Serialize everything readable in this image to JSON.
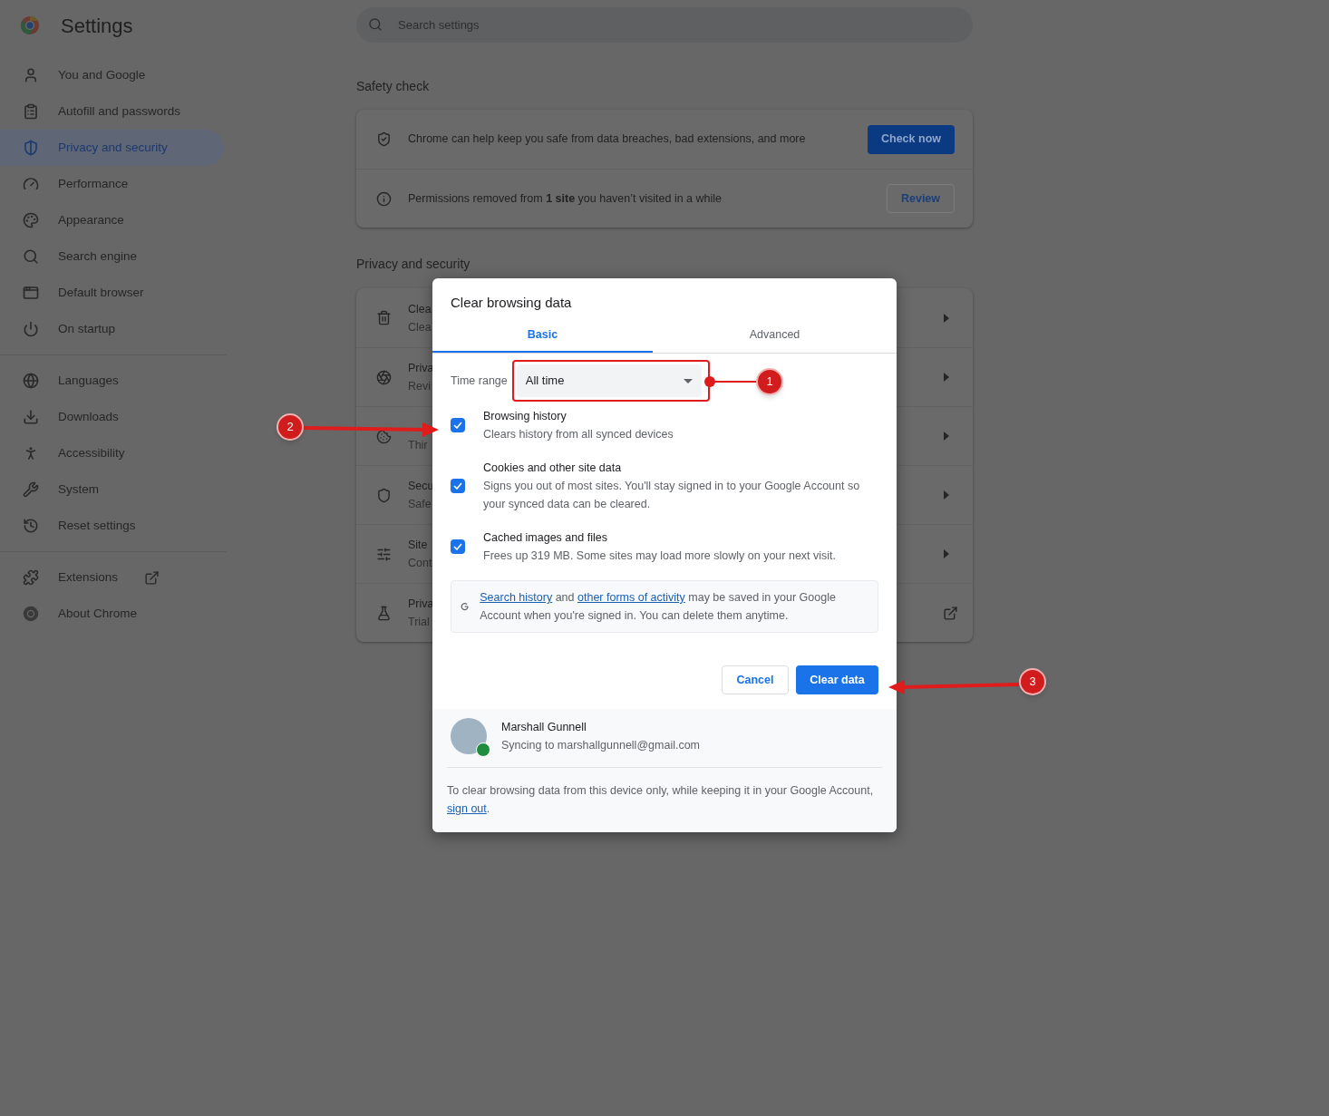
{
  "window": {
    "title": "Settings"
  },
  "search": {
    "placeholder": "Search settings"
  },
  "sidebar": {
    "groups": [
      [
        {
          "label": "You and Google",
          "selected": false,
          "external": false
        },
        {
          "label": "Autofill and passwords",
          "selected": false,
          "external": false
        },
        {
          "label": "Privacy and security",
          "selected": true,
          "external": false
        },
        {
          "label": "Performance",
          "selected": false,
          "external": false
        },
        {
          "label": "Appearance",
          "selected": false,
          "external": false
        },
        {
          "label": "Search engine",
          "selected": false,
          "external": false
        },
        {
          "label": "Default browser",
          "selected": false,
          "external": false
        },
        {
          "label": "On startup",
          "selected": false,
          "external": false
        }
      ],
      [
        {
          "label": "Languages",
          "selected": false,
          "external": false
        },
        {
          "label": "Downloads",
          "selected": false,
          "external": false
        },
        {
          "label": "Accessibility",
          "selected": false,
          "external": false
        },
        {
          "label": "System",
          "selected": false,
          "external": false
        },
        {
          "label": "Reset settings",
          "selected": false,
          "external": false
        }
      ],
      [
        {
          "label": "Extensions",
          "selected": false,
          "external": true
        },
        {
          "label": "About Chrome",
          "selected": false,
          "external": false
        }
      ]
    ]
  },
  "safety_check": {
    "heading": "Safety check",
    "rows": [
      {
        "text": "Chrome can help keep you safe from data breaches, bad extensions, and more",
        "button": "Check now",
        "kind": "primary"
      },
      {
        "text": "Permissions removed from **1 site** you haven’t visited in a while",
        "button": "Review",
        "kind": "secondary"
      }
    ]
  },
  "privacy": {
    "heading": "Privacy and security",
    "rows": [
      {
        "title": "Clea",
        "subtitle": "Clea",
        "kind": "arrow"
      },
      {
        "title": "Priva",
        "subtitle": "Revi",
        "kind": "arrow"
      },
      {
        "subtitle": "Thir",
        "kind": "arrow"
      },
      {
        "title": "Secu",
        "subtitle": "Safe",
        "kind": "arrow"
      },
      {
        "title": "Site",
        "subtitle": "Cont",
        "kind": "arrow"
      },
      {
        "title": "Priva",
        "subtitle": "Trial",
        "kind": "external"
      }
    ]
  },
  "dialog": {
    "title": "Clear browsing data",
    "tabs": [
      {
        "label": "Basic",
        "selected": true
      },
      {
        "label": "Advanced",
        "selected": false
      }
    ],
    "time_range": {
      "label": "Time range",
      "value": "All time"
    },
    "options": [
      {
        "title": "Browsing history",
        "description": "Clears history from all synced devices",
        "checked": true
      },
      {
        "title": "Cookies and other site data",
        "description": "Signs you out of most sites. You'll stay signed in to your Google Account so your synced data can be cleared.",
        "checked": true
      },
      {
        "title": "Cached images and files",
        "description": "Frees up 319 MB. Some sites may load more slowly on your next visit.",
        "checked": true
      }
    ],
    "notice": [
      {
        "text": "Search history",
        "link": true
      },
      {
        "text": " and ",
        "link": false
      },
      {
        "text": "other forms of activity",
        "link": true
      },
      {
        "text": " may be saved in your Google Account when you're signed in. You can delete them anytime.",
        "link": false
      }
    ],
    "buttons": [
      {
        "label": "Cancel",
        "kind": "secondary"
      },
      {
        "label": "Clear data",
        "kind": "primary"
      }
    ],
    "account": {
      "name": "Marshall Gunnell",
      "status": "Syncing to marshallgunnell@gmail.com"
    },
    "footer_note": [
      {
        "text": "To clear browsing data from this device only, while keeping it in your Google Account, ",
        "link": false
      },
      {
        "text": "sign out",
        "link": true
      },
      {
        "text": ".",
        "link": false
      }
    ]
  },
  "annotations": [
    {
      "label": "1"
    },
    {
      "label": "2"
    },
    {
      "label": "3"
    }
  ]
}
